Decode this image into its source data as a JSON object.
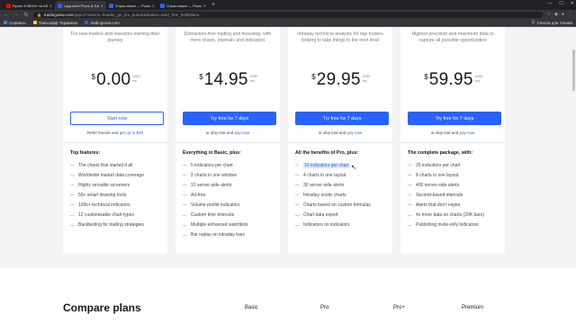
{
  "browser": {
    "tabs": [
      {
        "title": "Ryzen 5 5600X на ASUS Z170 …",
        "favicon_color": "#ff0000"
      },
      {
        "title": "Upgraded Plans & Extra Featur…",
        "favicon_color": "#2962ff"
      },
      {
        "title": "Отраслевые — Рынок акций — ЕС",
        "favicon_color": "#2962ff"
      },
      {
        "title": "Отраслевые — Рынок акций — ЕС",
        "favicon_color": "#2962ff"
      }
    ],
    "url_host": "tradingview.com",
    "url_path": "/gopro/?source=header_go_pro_button&feature=start_free_trial#plans",
    "bookmarks": [
      {
        "label": "Сервисы",
        "color": "#4285f4"
      },
      {
        "label": "Тинькофф Терминал",
        "color": "#ffdd2d"
      },
      {
        "label": "tradingview.com",
        "color": "#2962ff"
      }
    ],
    "bookmarks_right": "Список для чтения"
  },
  "plans": [
    {
      "desc": "For new traders and investors starting their journey",
      "currency": "$",
      "price": "0.00",
      "per": "USD/ mo",
      "button": "Start now",
      "button_style": "outline",
      "sub_text": "Refer friends and ",
      "sub_link": "get up to $30",
      "features_title": "Top features:",
      "features": [
        "The charts that started it all",
        "Worldwide market data coverage",
        "Highly versatile screeners",
        "50+ smart drawing tools",
        "100k+ technical indicators",
        "12 customizable chart types",
        "Backtesting for trading strategies"
      ]
    },
    {
      "desc": "Distraction-free trading and investing, with more charts, intervals and indicators",
      "currency": "$",
      "price": "14.95",
      "per": "USD/ mo",
      "button": "Try free for 7 days",
      "button_style": "solid",
      "sub_text": "or skip trial and ",
      "sub_link": "pay now",
      "features_title": "Everything in Basic, plus:",
      "features": [
        "5 indicators per chart",
        "2 charts in one window",
        "10 server-side alerts",
        "Ad-free",
        "Volume profile indicators",
        "Custom time intervals",
        "Multiple enhanced watchlists",
        "Bar replay on intraday bars"
      ]
    },
    {
      "desc": "Intraday technical analysis for day traders looking to take things to the next level",
      "currency": "$",
      "price": "29.95",
      "per": "USD/ mo",
      "button": "Try free for 7 days",
      "button_style": "solid",
      "sub_text": "or skip trial and ",
      "sub_link": "pay now",
      "features_title": "All the benefits of Pro, plus:",
      "features": [
        "10 indicators per chart",
        "4 charts in one layout",
        "30 server-side alerts",
        "Intraday exotic charts",
        "Charts based on custom formulas",
        "Chart data export",
        "Indicators on indicators"
      ]
    },
    {
      "desc": "Highest precision and maximum data to capture all possible opportunities",
      "currency": "$",
      "price": "59.95",
      "per": "USD/ mo",
      "button": "Try free for 7 days",
      "button_style": "solid",
      "sub_text": "or skip trial and ",
      "sub_link": "pay now",
      "features_title": "The complete package, with:",
      "features": [
        "25 indicators per chart",
        "8 charts in one layout",
        "400 server-side alerts",
        "Second-based intervals",
        "Alerts that don't expire",
        "4x more data on charts (20K bars)",
        "Publishing invite-only indicators"
      ]
    }
  ],
  "compare": {
    "title": "Compare plans",
    "columns": [
      "Basic",
      "Pro",
      "Pro+",
      "Premium"
    ]
  },
  "colors": {
    "accent": "#2962ff",
    "page_bg": "#f2f3f5"
  }
}
